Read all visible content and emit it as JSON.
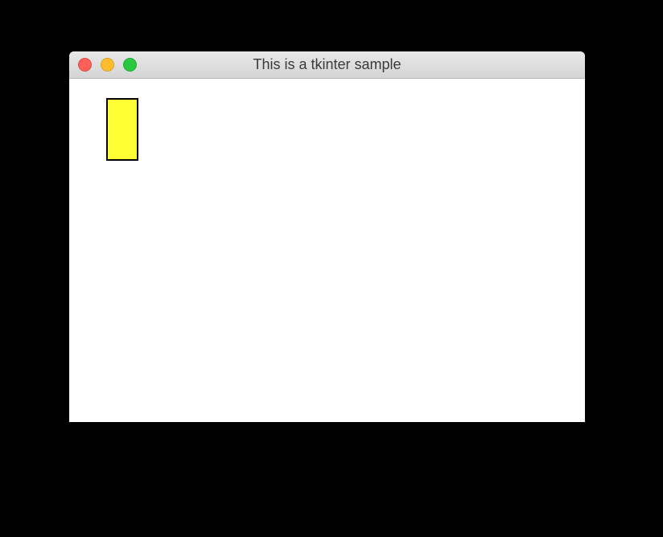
{
  "window": {
    "title": "This is a tkinter sample"
  },
  "canvas": {
    "rectangle": {
      "fill": "#ffff33",
      "stroke": "#000000"
    }
  }
}
